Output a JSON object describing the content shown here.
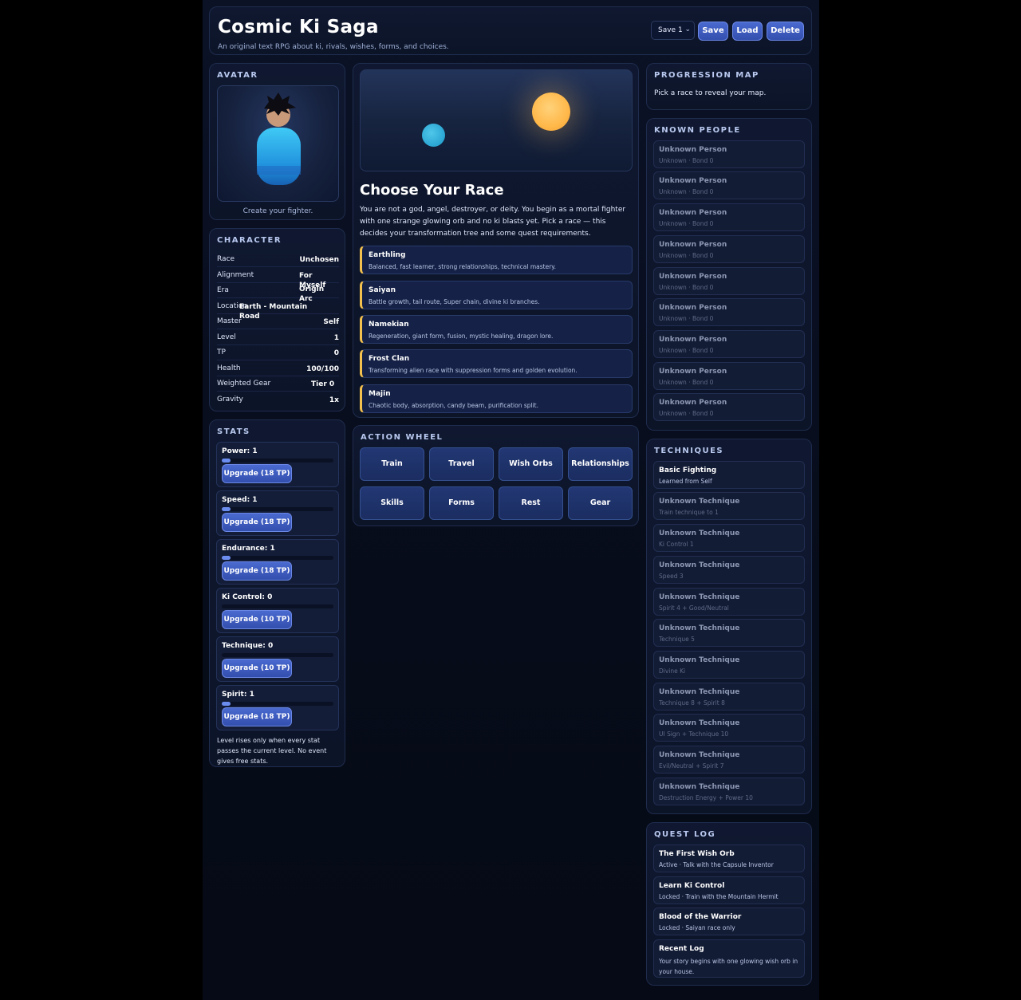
{
  "app": {
    "title": "Cosmic Ki Saga",
    "subtitle": "An original text RPG about ki, rivals, wishes, forms, and choices.",
    "save_slot": "Save 1",
    "buttons": {
      "save": "Save",
      "load": "Load",
      "delete": "Delete"
    },
    "accent": "#4a6ad0",
    "race_accent": "#f4c14f"
  },
  "avatar": {
    "title": "AVATAR",
    "caption": "Create your fighter."
  },
  "character": {
    "title": "CHARACTER",
    "rows": [
      {
        "key": "Race",
        "value": "Unchosen"
      },
      {
        "key": "Alignment",
        "value": "For Myself"
      },
      {
        "key": "Era",
        "value": "Origin Arc"
      },
      {
        "key": "Location",
        "value": "Earth - Mountain Road"
      },
      {
        "key": "Master",
        "value": "Self"
      },
      {
        "key": "Level",
        "value": "1"
      },
      {
        "key": "TP",
        "value": "0"
      },
      {
        "key": "Health",
        "value": "100/100"
      },
      {
        "key": "Weighted Gear",
        "value": "Tier 0"
      },
      {
        "key": "Gravity",
        "value": "1x"
      }
    ]
  },
  "stats": {
    "title": "STATS",
    "items": [
      {
        "label": "Power: 1",
        "button": "Upgrade (18 TP)",
        "fill": 0.08
      },
      {
        "label": "Speed: 1",
        "button": "Upgrade (18 TP)",
        "fill": 0.08
      },
      {
        "label": "Endurance: 1",
        "button": "Upgrade (18 TP)",
        "fill": 0.08
      },
      {
        "label": "Ki Control: 0",
        "button": "Upgrade (10 TP)",
        "fill": 0
      },
      {
        "label": "Technique: 0",
        "button": "Upgrade (10 TP)",
        "fill": 0
      },
      {
        "label": "Spirit: 1",
        "button": "Upgrade (18 TP)",
        "fill": 0.08
      }
    ],
    "note": "Level rises only when every stat passes the current level. No event gives free stats."
  },
  "story": {
    "title": "Choose Your Race",
    "description": "You are not a god, angel, destroyer, or deity. You begin as a mortal fighter with one strange glowing orb and no ki blasts yet. Pick a race — this decides your transformation tree and some quest requirements.",
    "races": [
      {
        "name": "Earthling",
        "desc": "Balanced, fast learner, strong relationships, technical mastery."
      },
      {
        "name": "Saiyan",
        "desc": "Battle growth, tail route, Super chain, divine ki branches."
      },
      {
        "name": "Namekian",
        "desc": "Regeneration, giant form, fusion, mystic healing, dragon lore."
      },
      {
        "name": "Frost Clan",
        "desc": "Transforming alien race with suppression forms and golden evolution."
      },
      {
        "name": "Majin",
        "desc": "Chaotic body, absorption, candy beam, purification split."
      }
    ]
  },
  "wheel": {
    "title": "ACTION WHEEL",
    "actions": [
      "Train",
      "Travel",
      "Wish Orbs",
      "Relationships",
      "Skills",
      "Forms",
      "Rest",
      "Gear"
    ]
  },
  "progression": {
    "title": "PROGRESSION MAP",
    "text": "Pick a race to reveal your map."
  },
  "people": {
    "title": "KNOWN PEOPLE",
    "items": [
      {
        "name": "Unknown Person",
        "sub": "Unknown · Bond 0"
      },
      {
        "name": "Unknown Person",
        "sub": "Unknown · Bond 0"
      },
      {
        "name": "Unknown Person",
        "sub": "Unknown · Bond 0"
      },
      {
        "name": "Unknown Person",
        "sub": "Unknown · Bond 0"
      },
      {
        "name": "Unknown Person",
        "sub": "Unknown · Bond 0"
      },
      {
        "name": "Unknown Person",
        "sub": "Unknown · Bond 0"
      },
      {
        "name": "Unknown Person",
        "sub": "Unknown · Bond 0"
      },
      {
        "name": "Unknown Person",
        "sub": "Unknown · Bond 0"
      },
      {
        "name": "Unknown Person",
        "sub": "Unknown · Bond 0"
      }
    ]
  },
  "techniques": {
    "title": "TECHNIQUES",
    "items": [
      {
        "name": "Basic Fighting",
        "sub": "Learned from Self",
        "known": true
      },
      {
        "name": "Unknown Technique",
        "sub": "Train technique to 1",
        "known": false
      },
      {
        "name": "Unknown Technique",
        "sub": "Ki Control 1",
        "known": false
      },
      {
        "name": "Unknown Technique",
        "sub": "Speed 3",
        "known": false
      },
      {
        "name": "Unknown Technique",
        "sub": "Spirit 4 + Good/Neutral",
        "known": false
      },
      {
        "name": "Unknown Technique",
        "sub": "Technique 5",
        "known": false
      },
      {
        "name": "Unknown Technique",
        "sub": "Divine Ki",
        "known": false
      },
      {
        "name": "Unknown Technique",
        "sub": "Technique 8 + Spirit 8",
        "known": false
      },
      {
        "name": "Unknown Technique",
        "sub": "UI Sign + Technique 10",
        "known": false
      },
      {
        "name": "Unknown Technique",
        "sub": "Evil/Neutral + Spirit 7",
        "known": false
      },
      {
        "name": "Unknown Technique",
        "sub": "Destruction Energy + Power 10",
        "known": false
      }
    ]
  },
  "quests": {
    "title": "QUEST LOG",
    "items": [
      {
        "name": "The First Wish Orb",
        "sub": "Active · Talk with the Capsule Inventor"
      },
      {
        "name": "Learn Ki Control",
        "sub": "Locked · Train with the Mountain Hermit"
      },
      {
        "name": "Blood of the Warrior",
        "sub": "Locked · Saiyan race only"
      },
      {
        "name": "Recent Log",
        "sub": "Your story begins with one glowing wish orb in your house."
      }
    ]
  }
}
